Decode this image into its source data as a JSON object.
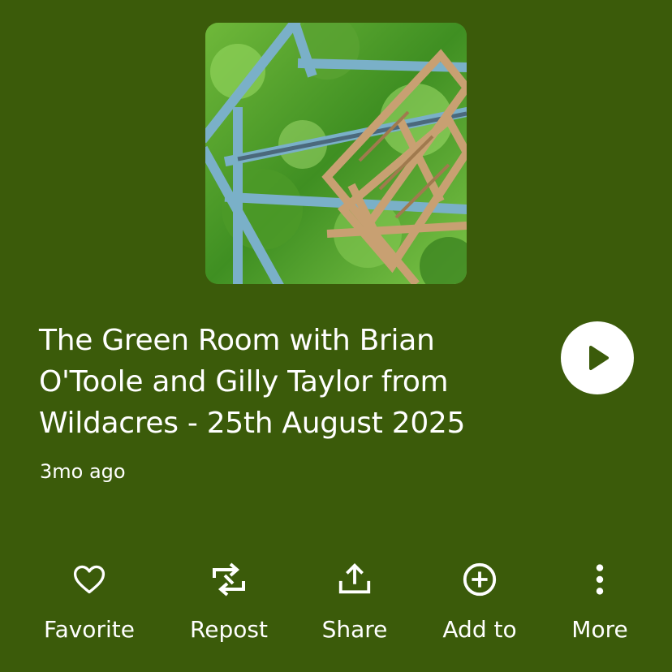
{
  "track": {
    "title": "The Green Room with Brian O'Toole and Gilly Taylor from Wildacres - 25th August 2025",
    "posted": "3mo ago"
  },
  "artwork": {
    "icon": "artwork-image",
    "colors": {
      "foliage": "#4d8f2a",
      "frame_blue": "#7ab0c8",
      "frame_wood": "#c8a072"
    }
  },
  "play": {
    "icon": "play-icon"
  },
  "actions": [
    {
      "label": "Favorite",
      "icon": "heart-icon"
    },
    {
      "label": "Repost",
      "icon": "repost-icon"
    },
    {
      "label": "Share",
      "icon": "share-icon"
    },
    {
      "label": "Add to",
      "icon": "add-circle-icon"
    },
    {
      "label": "More",
      "icon": "more-vertical-icon"
    }
  ],
  "colors": {
    "background": "#3b5b0a",
    "text": "#ffffff",
    "play_button": "#ffffff",
    "play_glyph": "#3b5b0a"
  }
}
